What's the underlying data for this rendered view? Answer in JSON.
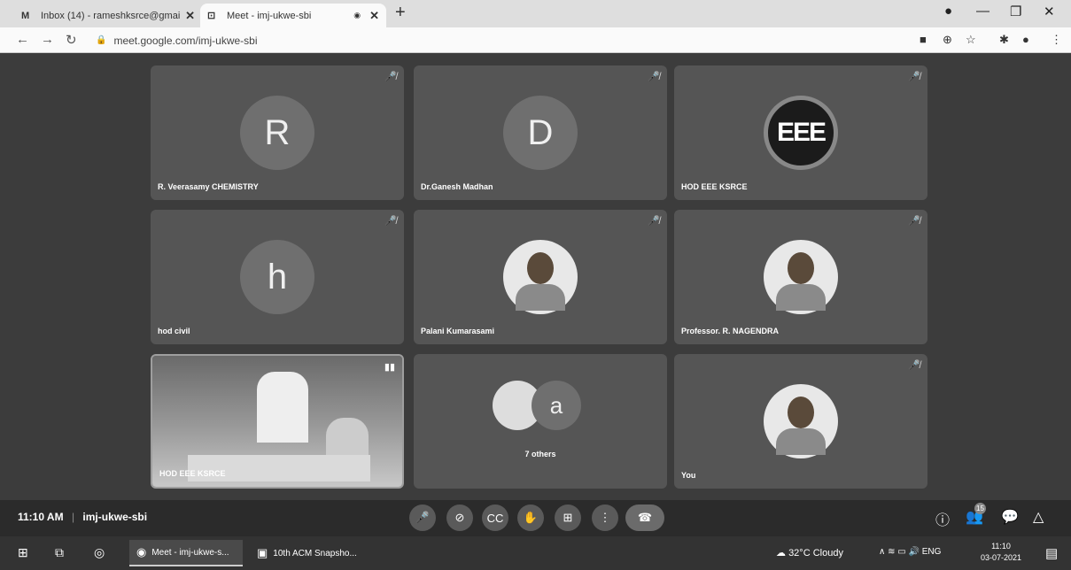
{
  "browser": {
    "tabs": [
      {
        "favicon": "M",
        "title": "Inbox (14) - rameshksrce@gmail",
        "close": "✕"
      },
      {
        "favicon": "⊡",
        "title": "Meet - imj-ukwe-sbi",
        "close": "✕",
        "recording": "◉"
      }
    ],
    "new_tab": "+",
    "url": "meet.google.com/imj-ukwe-sbi"
  },
  "tiles": [
    {
      "name": "R. Veerasamy CHEMISTRY",
      "avatar": "R"
    },
    {
      "name": "Dr.Ganesh Madhan",
      "avatar": "D"
    },
    {
      "name": "HOD EEE KSRCE",
      "logo": "EEE"
    },
    {
      "name": "hod civil",
      "avatar": "h"
    },
    {
      "name": "Palani Kumarasami"
    },
    {
      "name": "Professor. R. NAGENDRA"
    },
    {
      "name": "HOD EEE KSRCE"
    },
    {
      "name": "7 others",
      "avatar": "a"
    },
    {
      "name": "You"
    }
  ],
  "bottombar": {
    "time": "11:10 AM",
    "separator": "|",
    "meeting_code": "imj-ukwe-sbi",
    "people_count": "15"
  },
  "taskbar": {
    "items": [
      {
        "label": "Meet - imj-ukwe-s..."
      },
      {
        "label": "10th ACM Snapsho..."
      }
    ],
    "weather": "32°C Cloudy",
    "language": "ENG",
    "time": "11:10",
    "date": "03-07-2021"
  }
}
